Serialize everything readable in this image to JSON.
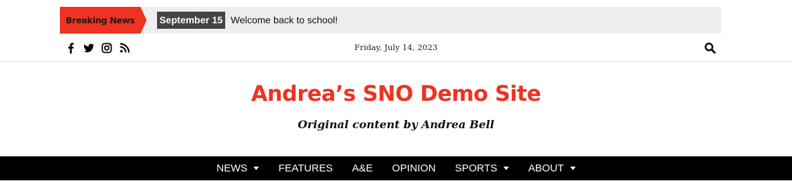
{
  "ticker": {
    "tag": "Breaking News",
    "date": "September 15",
    "headline": "Welcome back to school!",
    "accent": "#ee3322"
  },
  "utility": {
    "social_icons": [
      "facebook-icon",
      "twitter-icon",
      "instagram-icon",
      "rss-icon"
    ],
    "date": "Friday, July 14, 2023",
    "search_icon": "search-icon"
  },
  "masthead": {
    "title": "Andrea’s SNO Demo Site",
    "tagline": "Original content by Andrea Bell",
    "title_color": "#ee3322"
  },
  "nav": {
    "items": [
      {
        "label": "NEWS",
        "dropdown": true
      },
      {
        "label": "FEATURES",
        "dropdown": false
      },
      {
        "label": "A&E",
        "dropdown": false
      },
      {
        "label": "OPINION",
        "dropdown": false
      },
      {
        "label": "SPORTS",
        "dropdown": true
      },
      {
        "label": "ABOUT",
        "dropdown": true
      }
    ]
  }
}
